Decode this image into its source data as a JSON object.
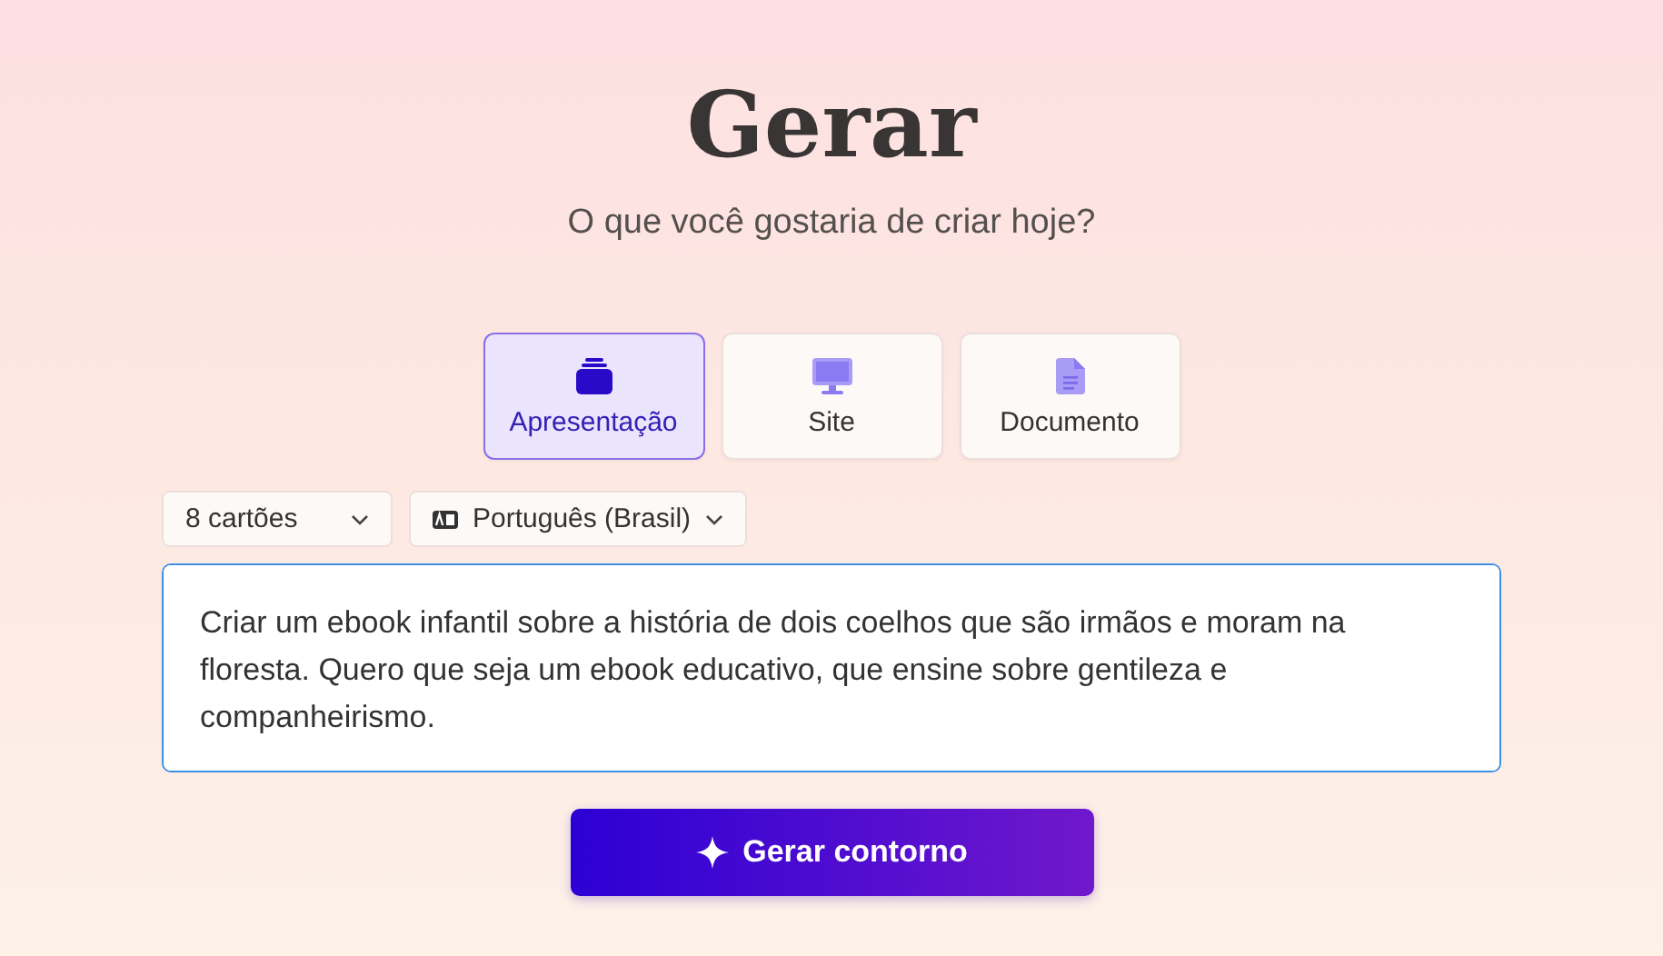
{
  "title": "Gerar",
  "subtitle": "O que você gostaria de criar hoje?",
  "tabs": [
    {
      "label": "Apresentação",
      "kind": "presentation",
      "selected": true
    },
    {
      "label": "Site",
      "kind": "site",
      "selected": false
    },
    {
      "label": "Documento",
      "kind": "document",
      "selected": false
    }
  ],
  "dropdowns": [
    {
      "label": "8 cartões",
      "kind": "count"
    },
    {
      "label": "Português (Brasil)",
      "kind": "language"
    }
  ],
  "prompt": {
    "value": "Criar um ebook infantil sobre a história de dois coelhos que são irmãos e moram na floresta. Quero que seja um ebook educativo, que ensine sobre gentileza e companheirismo."
  },
  "button": {
    "label": "Gerar contorno"
  }
}
